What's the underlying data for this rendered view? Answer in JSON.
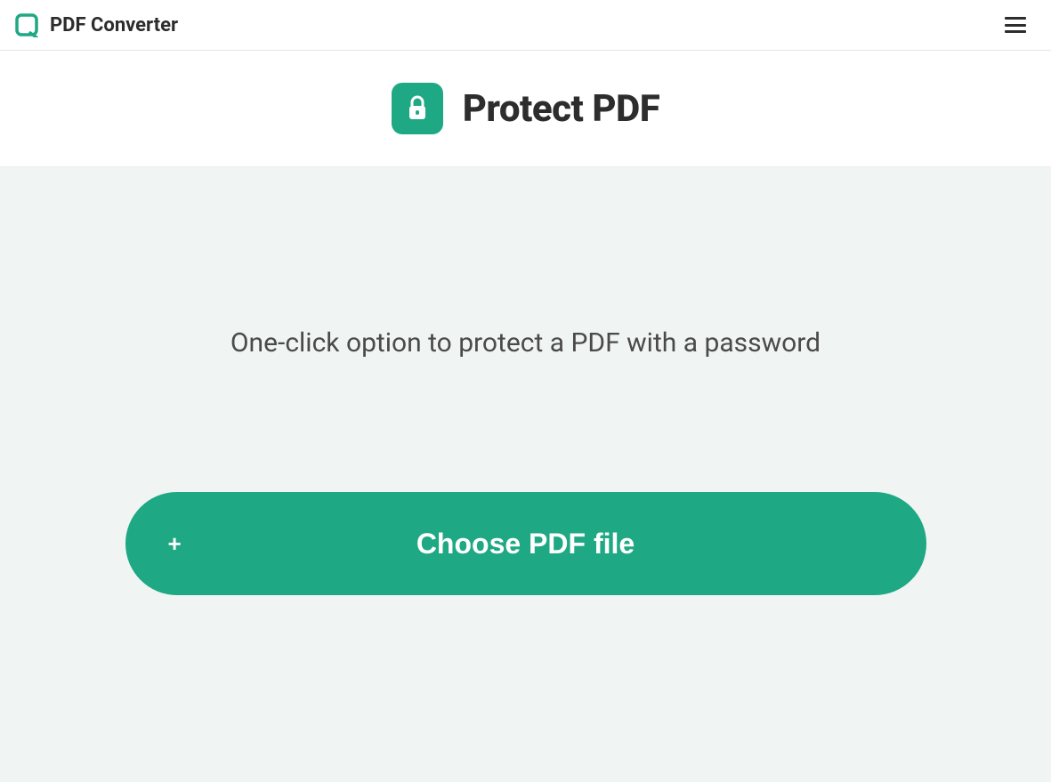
{
  "header": {
    "brand": "PDF Converter"
  },
  "title": {
    "heading": "Protect PDF"
  },
  "main": {
    "description": "One-click option to protect a PDF with a password",
    "choose_button_label": "Choose PDF file"
  }
}
